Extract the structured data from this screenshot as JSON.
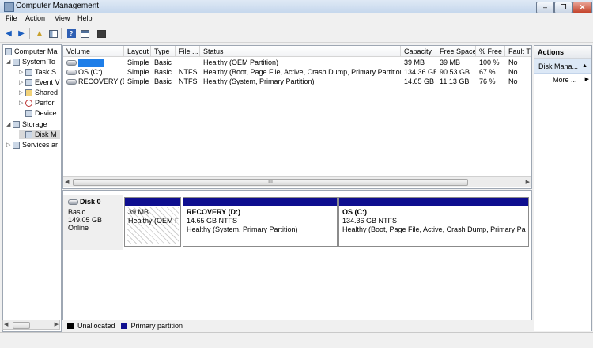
{
  "window": {
    "title": "Computer Management"
  },
  "menu": [
    "File",
    "Action",
    "View",
    "Help"
  ],
  "toolbar_icons": [
    "back-icon",
    "forward-icon",
    "up-folder-icon",
    "show-hide-tree-icon",
    "help-icon",
    "properties-icon",
    "console-icon"
  ],
  "tree": {
    "items": [
      {
        "label": "Computer Ma",
        "icon": "computer-icon"
      },
      {
        "label": "System To",
        "icon": "tools-icon"
      },
      {
        "label": "Task S",
        "icon": "clock-icon"
      },
      {
        "label": "Event V",
        "icon": "event-viewer-icon"
      },
      {
        "label": "Shared",
        "icon": "folder-icon"
      },
      {
        "label": "Perfor",
        "icon": "performance-icon"
      },
      {
        "label": "Device",
        "icon": "device-icon"
      },
      {
        "label": "Storage",
        "icon": "storage-icon"
      },
      {
        "label": "Disk M",
        "icon": "disk-icon"
      },
      {
        "label": "Services ar",
        "icon": "services-icon"
      }
    ]
  },
  "volume_list": {
    "columns": [
      "Volume",
      "Layout",
      "Type",
      "File ...",
      "Status",
      "Capacity",
      "Free Space",
      "% Free",
      "Fault T"
    ],
    "rows": [
      {
        "volume": "",
        "layout": "Simple",
        "type": "Basic",
        "fs": "",
        "status": "Healthy (OEM Partition)",
        "capacity": "39 MB",
        "free": "39 MB",
        "pct": "100 %",
        "fault": "No"
      },
      {
        "volume": "OS (C:)",
        "layout": "Simple",
        "type": "Basic",
        "fs": "NTFS",
        "status": "Healthy (Boot, Page File, Active, Crash Dump, Primary Partition)",
        "capacity": "134.36 GB",
        "free": "90.53 GB",
        "pct": "67 %",
        "fault": "No"
      },
      {
        "volume": "RECOVERY (D:)",
        "layout": "Simple",
        "type": "Basic",
        "fs": "NTFS",
        "status": "Healthy (System, Primary Partition)",
        "capacity": "14.65 GB",
        "free": "11.13 GB",
        "pct": "76 %",
        "fault": "No"
      }
    ],
    "scroll_grip": "III"
  },
  "disk_graph": {
    "disk": {
      "name": "Disk 0",
      "type": "Basic",
      "size": "149.05 GB",
      "state": "Online"
    },
    "partitions": [
      {
        "name": "",
        "size": "39 MB",
        "status": "Healthy (OEM Pa"
      },
      {
        "name": "RECOVERY  (D:)",
        "size": "14.65 GB NTFS",
        "status": "Healthy (System, Primary Partition)"
      },
      {
        "name": "OS  (C:)",
        "size": "134.36 GB NTFS",
        "status": "Healthy (Boot, Page File, Active, Crash Dump, Primary Partit"
      }
    ],
    "legend": [
      {
        "label": "Unallocated",
        "color": "#000000"
      },
      {
        "label": "Primary partition",
        "color": "#0e0e8f"
      }
    ]
  },
  "actions": {
    "title": "Actions",
    "section": "Disk Mana...",
    "more": "More ..."
  },
  "colors": {
    "primary_partition": "#0e0e8f",
    "selection": "#1e7ee8",
    "pane_border": "#9ea7b3"
  }
}
